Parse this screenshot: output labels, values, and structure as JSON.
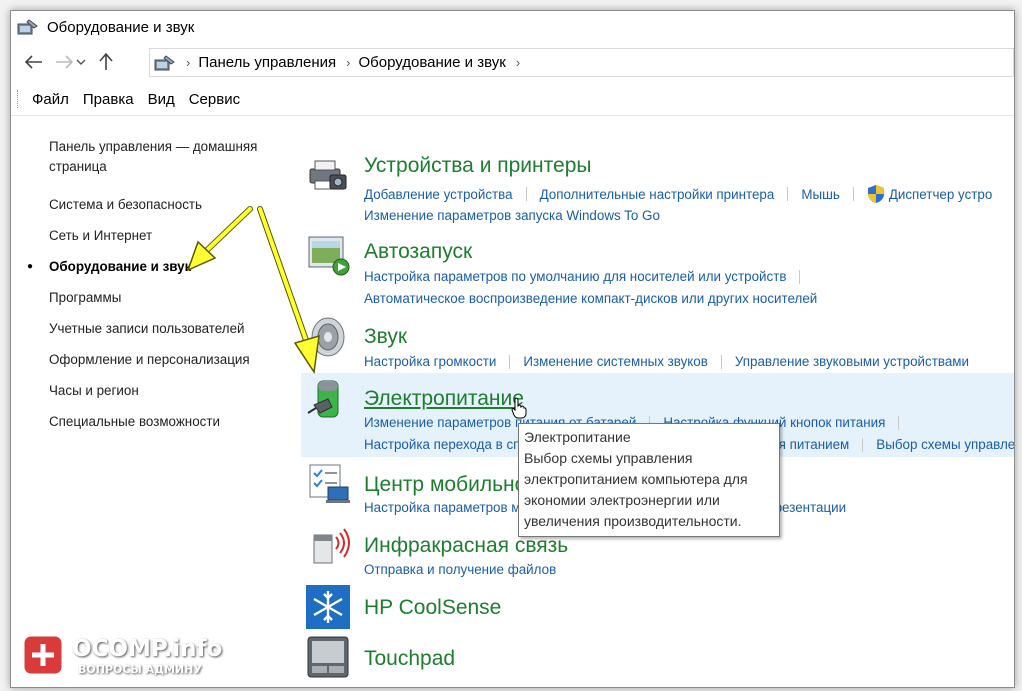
{
  "window": {
    "title": "Оборудование и звук"
  },
  "address": {
    "crumbs": [
      "Панель управления",
      "Оборудование и звук"
    ]
  },
  "menu": {
    "items": [
      "Файл",
      "Правка",
      "Вид",
      "Сервис"
    ]
  },
  "leftnav": {
    "home_line1": "Панель управления — домашняя",
    "home_line2": "страница",
    "items": [
      "Система и безопасность",
      "Сеть и Интернет",
      "Оборудование и звук",
      "Программы",
      "Учетные записи пользователей",
      "Оформление и персонализация",
      "Часы и регион",
      "Специальные возможности"
    ],
    "current_index": 2
  },
  "categories": [
    {
      "title": "Устройства и принтеры",
      "icon": "devices-printers-icon",
      "links_row1": [
        "Добавление устройства",
        "Дополнительные настройки принтера",
        "Мышь",
        "Диспетчер устро"
      ],
      "links_row2": [
        "Изменение параметров запуска Windows To Go"
      ]
    },
    {
      "title": "Автозапуск",
      "icon": "autoplay-icon",
      "links_row1": [
        "Настройка параметров по умолчанию для носителей или устройств"
      ],
      "links_row2": [
        "Автоматическое воспроизведение компакт-дисков или других носителей"
      ]
    },
    {
      "title": "Звук",
      "icon": "speaker-icon",
      "links_row1": [
        "Настройка громкости",
        "Изменение системных звуков",
        "Управление звуковыми устройствами"
      ]
    },
    {
      "title": "Электропитание",
      "icon": "battery-icon",
      "links_row1": [
        "Изменение параметров питания от батарей",
        "Настройка функций кнопок питания"
      ],
      "links_row2": [
        "Настройка перехода в спящий режим",
        "Выбор схемы управления питанием",
        "Выбор схемы управления пит"
      ]
    },
    {
      "title": "Центр мобильности Windows",
      "icon": "mobility-center-icon",
      "links_row1": [
        "Настройка параметров мобильности",
        "Настройка параметров презентации"
      ]
    },
    {
      "title": "Инфракрасная связь",
      "icon": "infrared-icon",
      "links_row1": [
        "Отправка и получение файлов"
      ]
    },
    {
      "title": "HP CoolSense",
      "icon": "snowflake-icon"
    },
    {
      "title": "Touchpad",
      "icon": "touchpad-icon"
    }
  ],
  "tooltip": {
    "title": "Электропитание",
    "lines": [
      "Выбор схемы управления",
      "электропитанием компьютера для",
      "экономии электроэнергии или",
      "увеличения производительности."
    ]
  },
  "watermark": {
    "brand": "OCOMP.info",
    "sub": "ВОПРОСЫ АДМИНУ"
  },
  "colors": {
    "category_title": "#1e7d2f",
    "link": "#1a5ea8",
    "highlight": "#e5f1fb",
    "arrow": "#ffff33"
  }
}
